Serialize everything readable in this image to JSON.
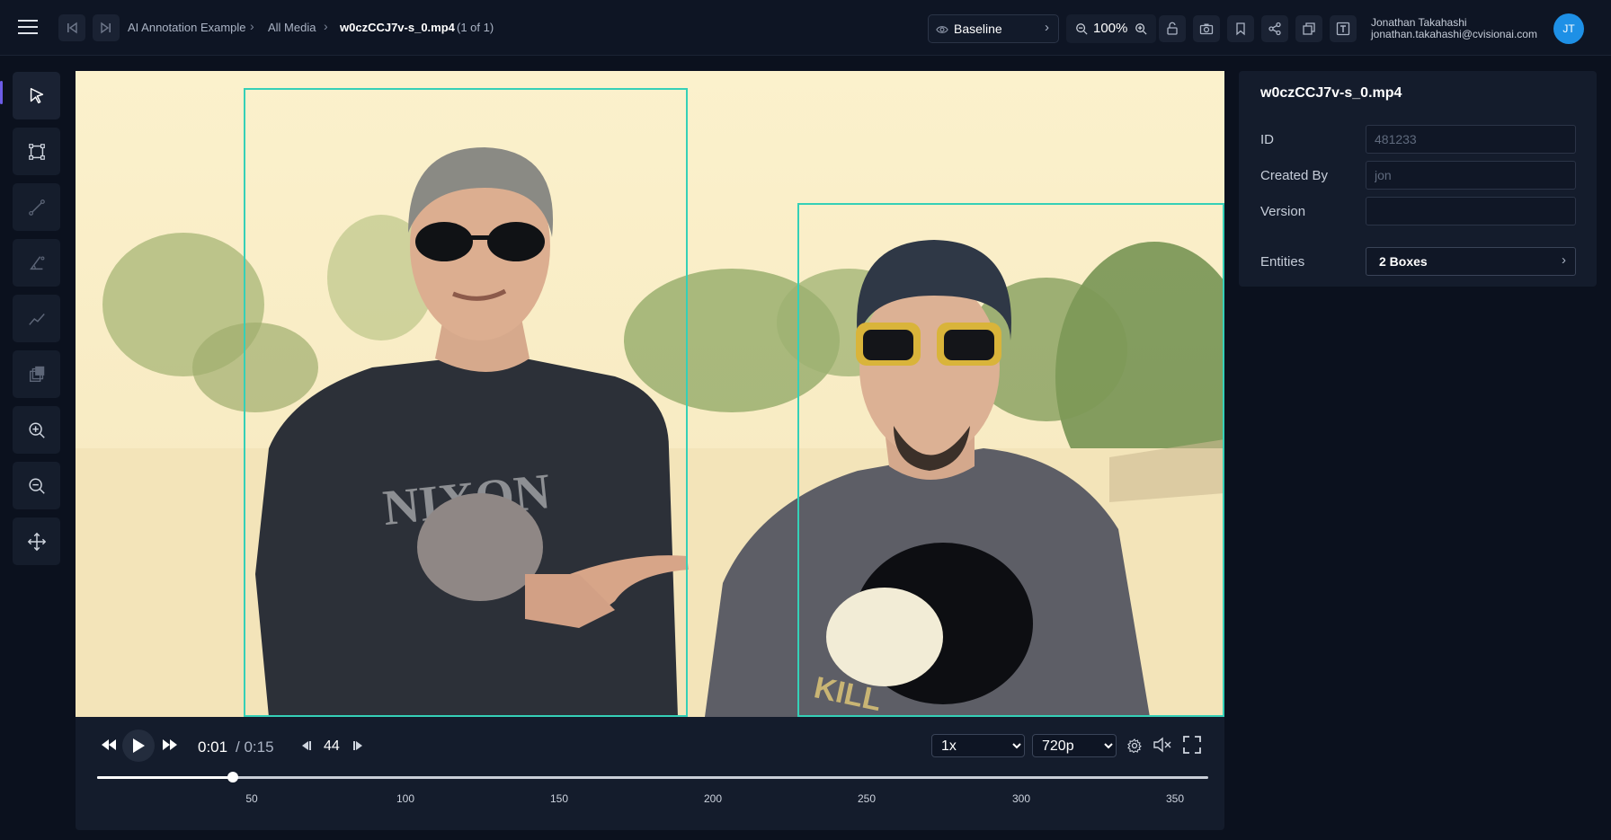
{
  "header": {
    "breadcrumb": [
      "AI Annotation Example",
      "All Media"
    ],
    "file_name": "w0czCCJ7v-s_0.mp4",
    "file_position": "(1 of 1)",
    "layer_label": "Baseline",
    "zoom_label": "100%",
    "user_name": "Jonathan Takahashi",
    "user_email": "jonathan.takahashi@cvisionai.com",
    "avatar_initials": "JT"
  },
  "player": {
    "current_time": "0:01",
    "total_time": "/ 0:15",
    "frame": "44",
    "speed_selected": "1x",
    "quality_selected": "720p",
    "timeline_ticks": [
      "50",
      "100",
      "150",
      "200",
      "250",
      "300",
      "350"
    ]
  },
  "panel": {
    "title": "w0czCCJ7v-s_0.mp4",
    "id_label": "ID",
    "id_value": "481233",
    "created_by_label": "Created By",
    "created_by_value": "jon",
    "version_label": "Version",
    "version_value": "",
    "entities_label": "Entities",
    "entities_value": "2 Boxes"
  },
  "colors": {
    "accent": "#35d0b7",
    "avatar": "#1e90e6",
    "background": "#0b111e",
    "panel": "#141c2c"
  },
  "icons": [
    "menu-icon",
    "skip-back-icon",
    "skip-forward-icon",
    "eye-icon",
    "zoom-out-icon",
    "zoom-in-icon",
    "unlock-icon",
    "camera-icon",
    "bookmark-icon",
    "share-icon",
    "stack-icon",
    "text-box-icon",
    "pointer-icon",
    "box-icon",
    "line-icon",
    "angle-icon",
    "polyline-icon",
    "layers-icon",
    "pan-icon",
    "rewind-icon",
    "play-icon",
    "fast-forward-icon",
    "settings-icon",
    "mute-icon",
    "fullscreen-icon",
    "chevron-right-icon"
  ]
}
